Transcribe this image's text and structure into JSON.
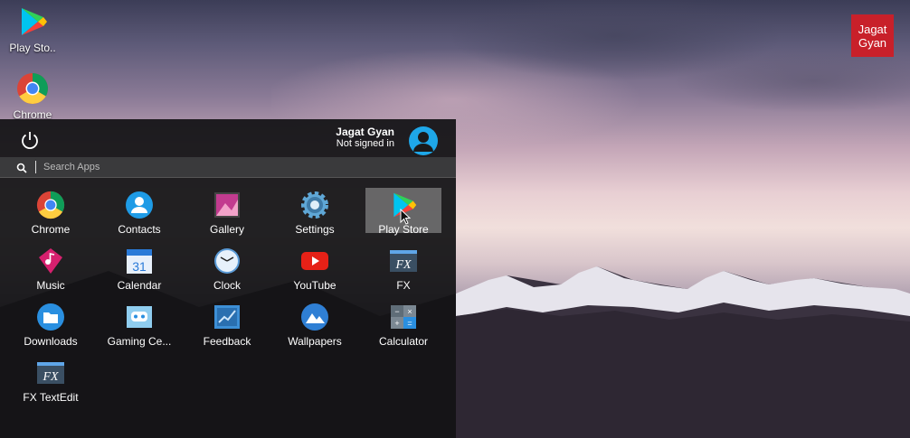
{
  "desktop": {
    "icons": [
      {
        "label": "Play Sto..",
        "icon": "play-store-icon"
      },
      {
        "label": "Chrome",
        "icon": "chrome-icon"
      }
    ],
    "brand": {
      "line1": "Jagat",
      "line2": "Gyan",
      "color": "#c8202a"
    }
  },
  "launcher": {
    "user": {
      "name": "Jagat Gyan",
      "status": "Not signed in"
    },
    "search": {
      "placeholder": "Search Apps"
    },
    "apps": [
      {
        "label": "Chrome",
        "icon": "chrome-icon"
      },
      {
        "label": "Contacts",
        "icon": "contacts-icon"
      },
      {
        "label": "Gallery",
        "icon": "gallery-icon"
      },
      {
        "label": "Settings",
        "icon": "settings-icon"
      },
      {
        "label": "Play Store",
        "icon": "play-store-icon",
        "selected": true
      },
      {
        "label": "Music",
        "icon": "music-icon"
      },
      {
        "label": "Calendar",
        "icon": "calendar-icon",
        "badge": "31"
      },
      {
        "label": "Clock",
        "icon": "clock-icon"
      },
      {
        "label": "YouTube",
        "icon": "youtube-icon"
      },
      {
        "label": "FX",
        "icon": "fx-icon",
        "badge": "FX"
      },
      {
        "label": "Downloads",
        "icon": "downloads-icon"
      },
      {
        "label": "Gaming Ce...",
        "icon": "gaming-center-icon"
      },
      {
        "label": "Feedback",
        "icon": "feedback-icon"
      },
      {
        "label": "Wallpapers",
        "icon": "wallpapers-icon"
      },
      {
        "label": "Calculator",
        "icon": "calculator-icon"
      },
      {
        "label": "FX TextEdit",
        "icon": "fx-textedit-icon",
        "badge": "FX"
      }
    ]
  }
}
